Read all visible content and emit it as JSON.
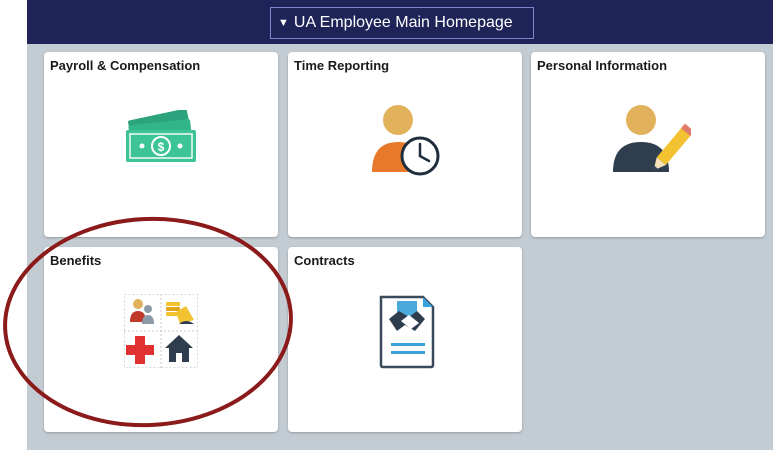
{
  "header": {
    "homepage_label": "UA Employee Main Homepage",
    "caret_icon": "triangle-down-icon",
    "background": "#1e2358"
  },
  "tiles": [
    {
      "title": "Payroll & Compensation",
      "icon": "money-icon"
    },
    {
      "title": "Time Reporting",
      "icon": "person-clock-icon"
    },
    {
      "title": "Personal Information",
      "icon": "person-pencil-icon"
    },
    {
      "title": "Benefits",
      "icon": "benefits-grid-icon"
    },
    {
      "title": "Contracts",
      "icon": "contract-document-icon"
    }
  ],
  "annotation": {
    "shape": "oval",
    "color": "#8b1a1a",
    "target": "Benefits"
  }
}
